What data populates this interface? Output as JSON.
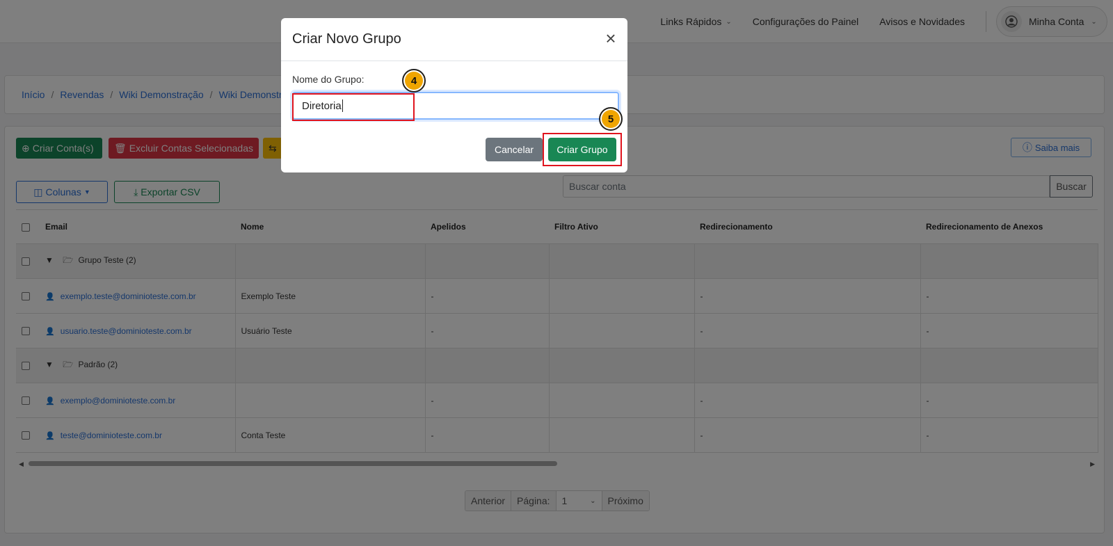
{
  "navbar": {
    "quick_links": "Links Rápidos",
    "panel_settings": "Configurações do Painel",
    "news": "Avisos e Novidades",
    "account": "Minha Conta"
  },
  "breadcrumb": [
    "Início",
    "Revendas",
    "Wiki Demonstração",
    "Wiki Demonstr"
  ],
  "toolbar": {
    "create_accounts": "Criar Conta(s)",
    "delete_selected": "Excluir Contas Selecionadas",
    "learn_more": "Saiba mais",
    "columns": "Colunas",
    "export_csv": "Exportar CSV",
    "search_placeholder": "Buscar conta",
    "search_button": "Buscar"
  },
  "table": {
    "headers": [
      "Email",
      "Nome",
      "Apelidos",
      "Filtro Ativo",
      "Redirecionamento",
      "Redirecionamento de Anexos"
    ],
    "groups": [
      {
        "label": "Grupo Teste (2)",
        "rows": [
          {
            "email": "exemplo.teste@dominioteste.com.br",
            "name": "Exemplo Teste",
            "aliases": "-",
            "filter": "",
            "redirect": "-",
            "attach_redirect": "-"
          },
          {
            "email": "usuario.teste@dominioteste.com.br",
            "name": "Usuário Teste",
            "aliases": "-",
            "filter": "",
            "redirect": "-",
            "attach_redirect": "-"
          }
        ]
      },
      {
        "label": "Padrão (2)",
        "rows": [
          {
            "email": "exemplo@dominioteste.com.br",
            "name": "",
            "aliases": "-",
            "filter": "",
            "redirect": "-",
            "attach_redirect": "-"
          },
          {
            "email": "teste@dominioteste.com.br",
            "name": "Conta Teste",
            "aliases": "-",
            "filter": "",
            "redirect": "-",
            "attach_redirect": "-"
          }
        ]
      }
    ]
  },
  "pagination": {
    "previous": "Anterior",
    "page_label": "Página:",
    "page_value": "1",
    "next": "Próximo"
  },
  "modal": {
    "title": "Criar Novo Grupo",
    "field_label": "Nome do Grupo:",
    "field_value": "Diretoria",
    "cancel": "Cancelar",
    "create": "Criar Grupo"
  },
  "steps": {
    "input_step": "4",
    "create_step": "5"
  },
  "colors": {
    "primary": "#2a6fd6",
    "success": "#198754",
    "danger": "#dc3545",
    "warning": "#ffc107",
    "highlight": "#e0141e",
    "step_badge": "#f0a500"
  }
}
